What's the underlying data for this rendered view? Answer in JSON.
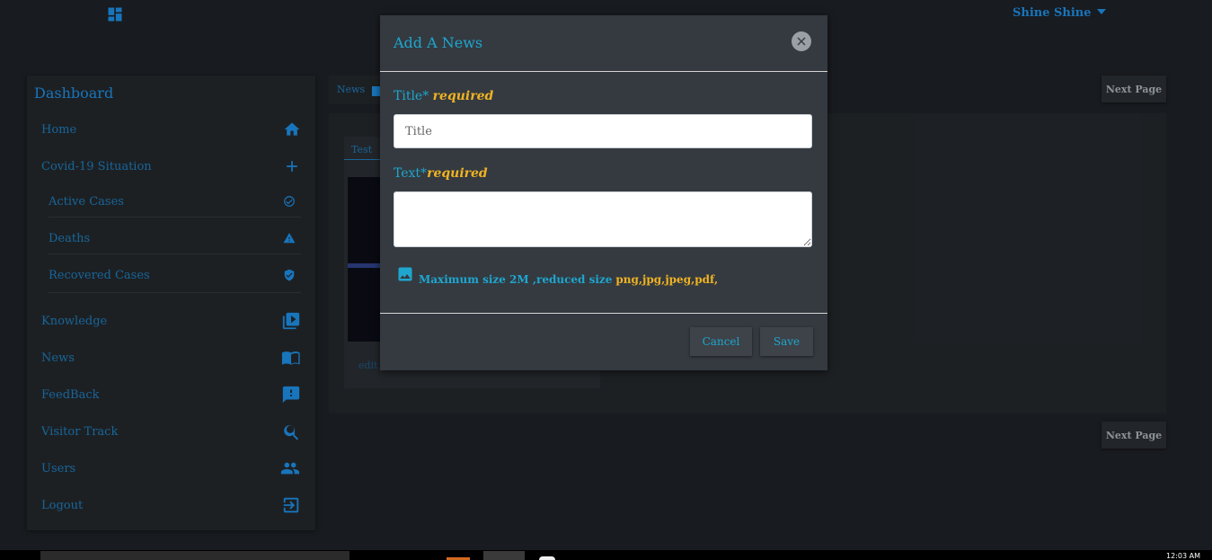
{
  "topbar": {
    "user_name": "Shine Shine"
  },
  "sidebar": {
    "title": "Dashboard",
    "items": [
      {
        "label": "Home",
        "icon": "home-icon"
      },
      {
        "label": "Covid-19 Situation",
        "icon": "plus-icon"
      },
      {
        "label": "Active Cases",
        "icon": "check-circle-icon"
      },
      {
        "label": "Deaths",
        "icon": "warning-icon"
      },
      {
        "label": "Recovered Cases",
        "icon": "shield-icon"
      },
      {
        "label": "Knowledge",
        "icon": "video-library-icon"
      },
      {
        "label": "News",
        "icon": "book-icon"
      },
      {
        "label": "FeedBack",
        "icon": "feedback-icon"
      },
      {
        "label": "Visitor Track",
        "icon": "search-refresh-icon"
      },
      {
        "label": "Users",
        "icon": "people-icon"
      },
      {
        "label": "Logout",
        "icon": "logout-icon"
      }
    ]
  },
  "main": {
    "breadcrumb": "News",
    "next_page_label": "Next Page",
    "card": {
      "tab_label": "Test",
      "edit_label": "edit"
    }
  },
  "modal": {
    "title": "Add A News",
    "title_label": "Title*",
    "required_label": "required",
    "title_placeholder": "Title",
    "text_label": "Text*",
    "upload_note": "Maximum size 2M ,reduced size",
    "file_types": "png,jpg,jpeg,pdf,",
    "cancel_label": "Cancel",
    "save_label": "Save"
  },
  "taskbar": {
    "clock": "12:03 AM"
  },
  "colors": {
    "accent": "#1fa6cf",
    "brand": "#1b7fcc",
    "required": "#f0b323",
    "modal_bg": "#343a40",
    "page_bg": "#1b1e22"
  }
}
